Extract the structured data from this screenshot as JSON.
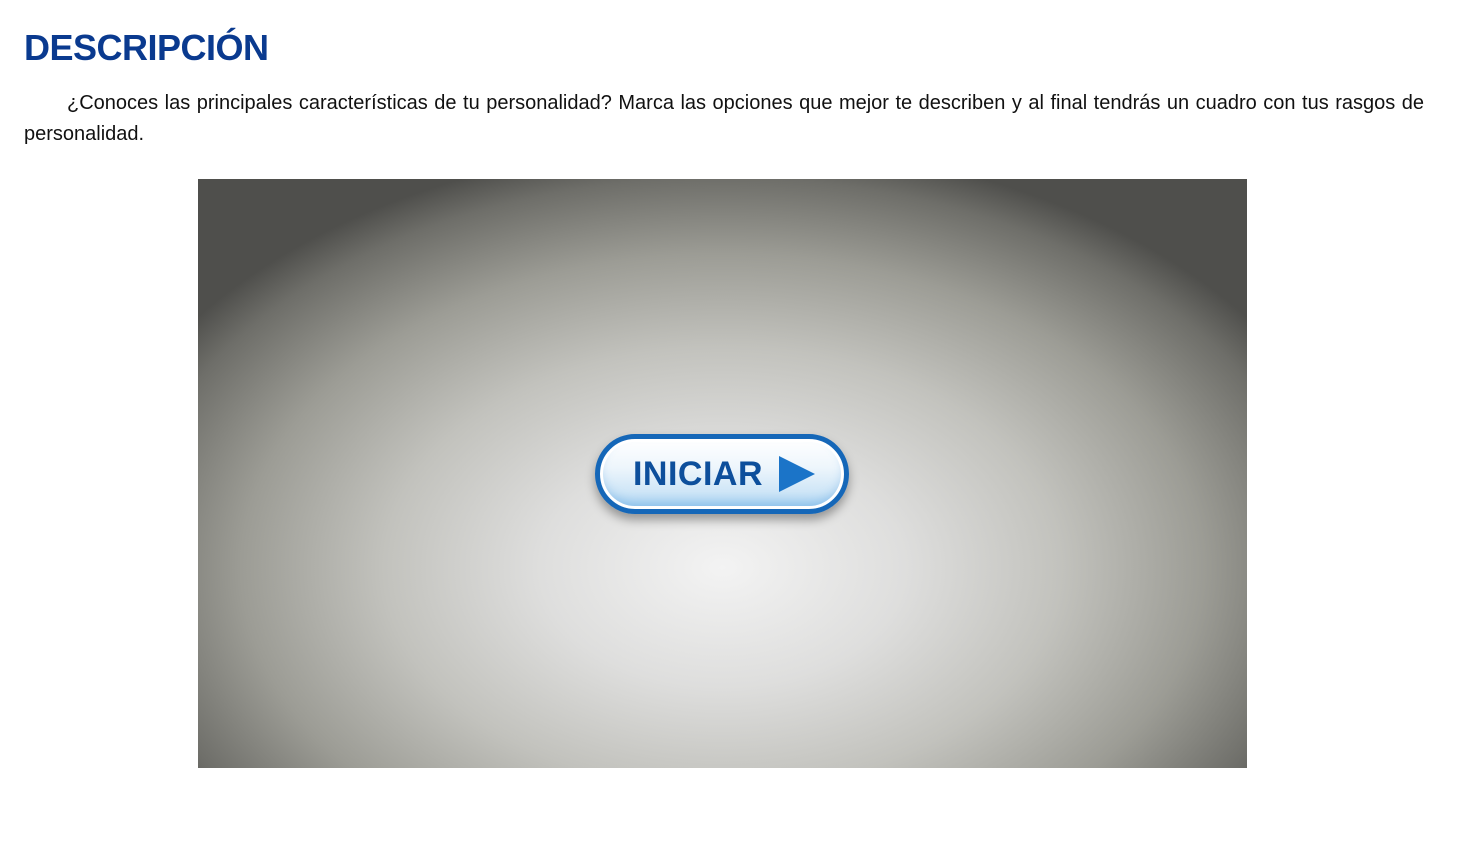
{
  "header": {
    "title": "DESCRIPCIÓN"
  },
  "main": {
    "description": "¿Conoces las principales características de tu personalidad? Marca las opciones que mejor te describen y al final tendrás un cuadro con tus rasgos de personalidad."
  },
  "activity": {
    "start_label": "INICIAR",
    "start_icon": "play-icon",
    "button_color": "#1567b8"
  }
}
